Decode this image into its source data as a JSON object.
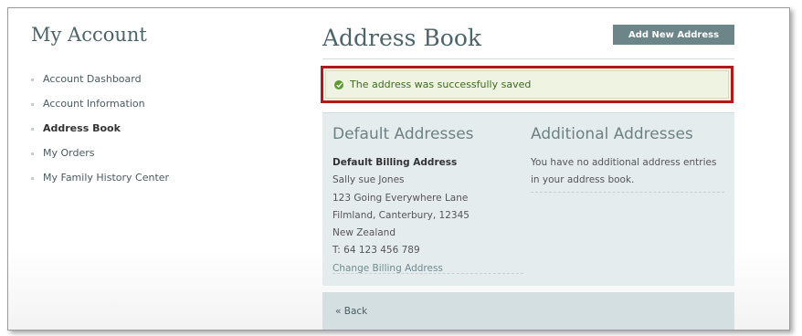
{
  "sidebar": {
    "title": "My Account",
    "items": [
      {
        "label": "Account Dashboard"
      },
      {
        "label": "Account Information"
      },
      {
        "label": "Address Book"
      },
      {
        "label": "My Orders"
      },
      {
        "label": "My Family History Center"
      }
    ],
    "active_item": "Address Book"
  },
  "main": {
    "title": "Address Book",
    "add_button": "Add New Address",
    "success_message": "The address was successfully saved",
    "default_addresses": {
      "heading": "Default Addresses",
      "billing_heading": "Default Billing Address",
      "name": "Sally sue Jones",
      "street": "123 Going Everywhere Lane",
      "city_line": "Filmland, Canterbury, 12345",
      "country": "New Zealand",
      "phone": "T: 64 123 456 789",
      "change_link": "Change Billing Address"
    },
    "additional_addresses": {
      "heading": "Additional Addresses",
      "empty_text": "You have no additional address entries in your address book."
    },
    "back_link": "« Back"
  },
  "colors": {
    "accent": "#6b8589",
    "highlight_border": "#b4171b",
    "success_bg": "#eef3e2",
    "success_icon": "#5c9a32",
    "panel_bg": "#e5ecee"
  }
}
